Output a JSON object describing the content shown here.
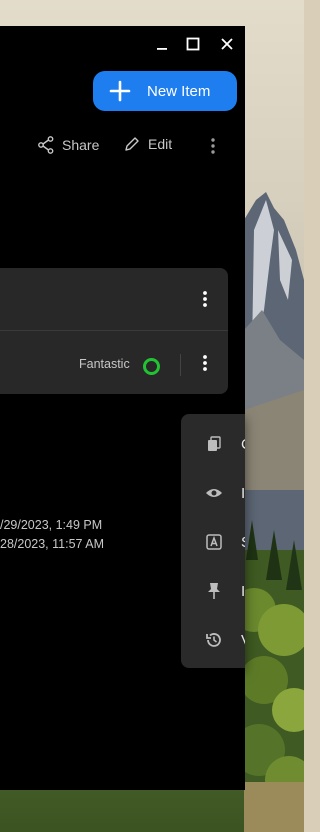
{
  "window": {
    "controls": {
      "minimize": "minimize",
      "maximize": "maximize",
      "close": "close"
    }
  },
  "header": {
    "new_item_label": "New Item"
  },
  "toolbar": {
    "share_label": "Share",
    "edit_label": "Edit"
  },
  "list": {
    "row2_status": "Fantastic",
    "status_color": "#22c332"
  },
  "details": {
    "timestamp1": "/29/2023, 1:49 PM",
    "timestamp2": "28/2023, 11:57 AM"
  },
  "context_menu": {
    "items": [
      {
        "icon": "copy-icon",
        "label": "C"
      },
      {
        "icon": "eye-icon",
        "label": "I"
      },
      {
        "icon": "text-a-icon",
        "label": "S"
      },
      {
        "icon": "pin-icon",
        "label": "I"
      },
      {
        "icon": "history-icon",
        "label": "V"
      }
    ]
  },
  "colors": {
    "accent": "#1e7ef0",
    "window_bg": "#000000",
    "card_bg": "#282828",
    "menu_bg": "#2a2a2a"
  }
}
